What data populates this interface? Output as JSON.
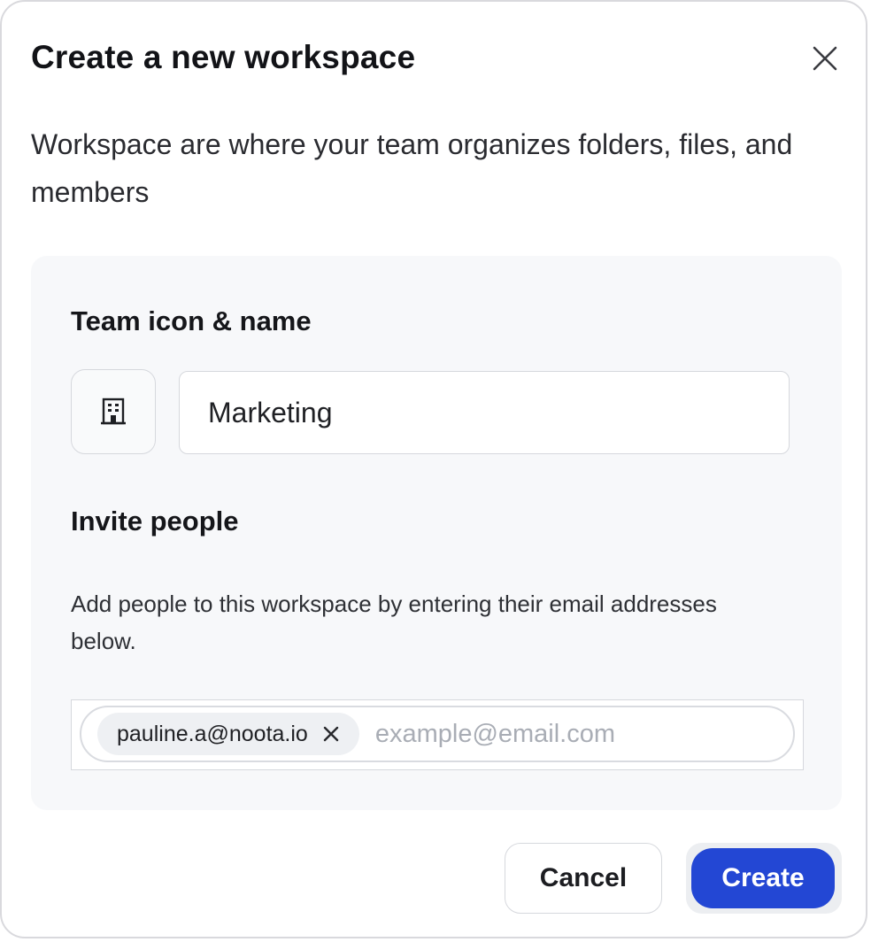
{
  "dialog": {
    "title": "Create a new workspace",
    "description": "Workspace are where your team organizes folders, files, and members",
    "close_icon": "close-icon"
  },
  "team": {
    "section_label": "Team icon & name",
    "icon": "building-icon",
    "name_value": "Marketing"
  },
  "invite": {
    "section_label": "Invite people",
    "help_text": "Add people to this workspace by entering their email addresses below.",
    "chips": [
      {
        "email": "pauline.a@noota.io",
        "remove_icon": "close-icon"
      }
    ],
    "placeholder": "example@email.com"
  },
  "actions": {
    "cancel_label": "Cancel",
    "create_label": "Create"
  },
  "colors": {
    "primary": "#2347d4",
    "panel_bg": "#f7f8fa",
    "border": "#d6d8dd"
  }
}
